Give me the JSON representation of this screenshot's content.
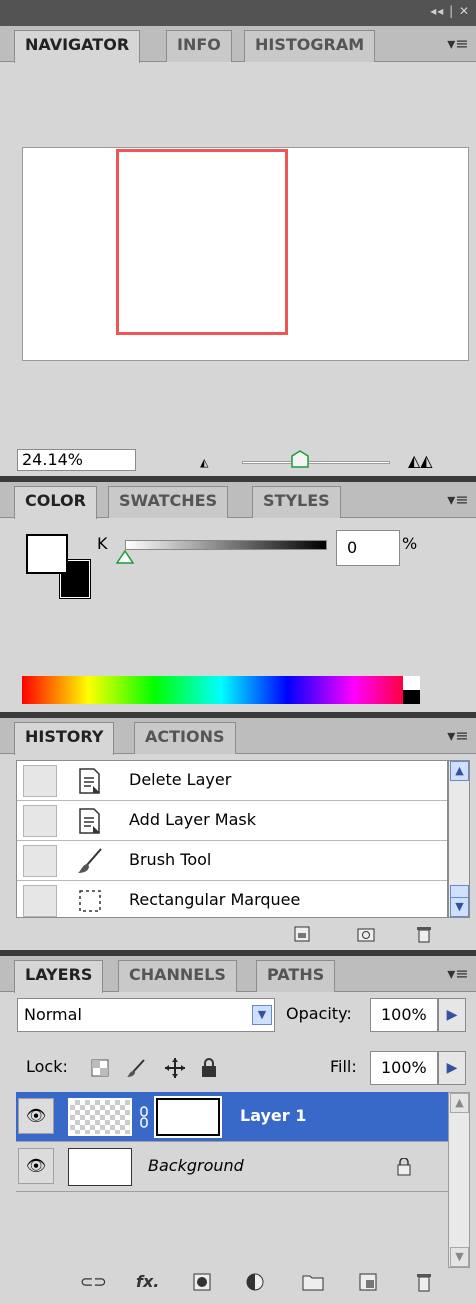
{
  "window": {
    "controls_text": "◂◂ | ✕"
  },
  "navigator": {
    "tabs": [
      "NAVIGATOR",
      "INFO",
      "HISTOGRAM"
    ],
    "zoom_value": "24.14%",
    "zoom_slider_level": 0.42
  },
  "color": {
    "tabs": [
      "COLOR",
      "SWATCHES",
      "STYLES"
    ],
    "channel_label": "K",
    "channel_value": "0",
    "unit": "%",
    "foreground": "#ffffff",
    "background": "#000000"
  },
  "history": {
    "tabs": [
      "HISTORY",
      "ACTIONS"
    ],
    "items": [
      {
        "label": "Delete Layer",
        "icon": "history-state-icon"
      },
      {
        "label": "Add Layer Mask",
        "icon": "history-state-icon"
      },
      {
        "label": "Brush Tool",
        "icon": "brush-icon"
      },
      {
        "label": "Rectangular Marquee",
        "icon": "marquee-icon"
      }
    ]
  },
  "layers": {
    "tabs": [
      "LAYERS",
      "CHANNELS",
      "PATHS"
    ],
    "blend_mode": "Normal",
    "opacity_label": "Opacity:",
    "opacity_value": "100%",
    "lock_label": "Lock:",
    "fill_label": "Fill:",
    "fill_value": "100%",
    "rows": [
      {
        "name": "Layer 1",
        "selected": true
      },
      {
        "name": "Background",
        "selected": false
      }
    ]
  },
  "colors": {
    "selection": "#3868c8",
    "nav_box": "#ef5555"
  }
}
